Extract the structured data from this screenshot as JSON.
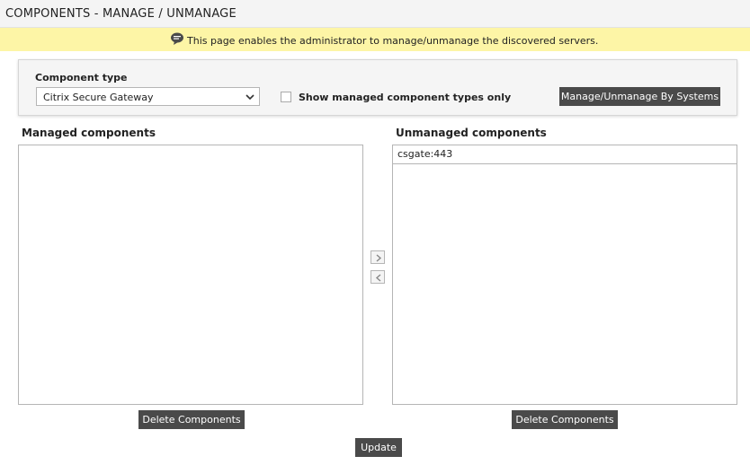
{
  "header": {
    "title": "COMPONENTS - MANAGE / UNMANAGE"
  },
  "info": {
    "icon": "speech-bubble-icon",
    "text": "This page enables the administrator to manage/unmanage the discovered servers."
  },
  "filters": {
    "component_type_label": "Component type",
    "component_type_value": "Citrix Secure Gateway",
    "show_managed_label": "Show managed component types only",
    "show_managed_checked": false,
    "manage_by_systems_label": "Manage/Unmanage By Systems"
  },
  "managed": {
    "label": "Managed components",
    "items": [],
    "delete_label": "Delete Components"
  },
  "unmanaged": {
    "label": "Unmanaged components",
    "items": [
      "csgate:443"
    ],
    "delete_label": "Delete Components"
  },
  "transfer": {
    "move_right_icon": "chevron-right-icon",
    "move_left_icon": "chevron-left-icon"
  },
  "actions": {
    "update_label": "Update"
  },
  "colors": {
    "info_bar": "#fdf5a6",
    "button_bg": "#4a4a4a",
    "panel_bg": "#f5f5f5"
  }
}
